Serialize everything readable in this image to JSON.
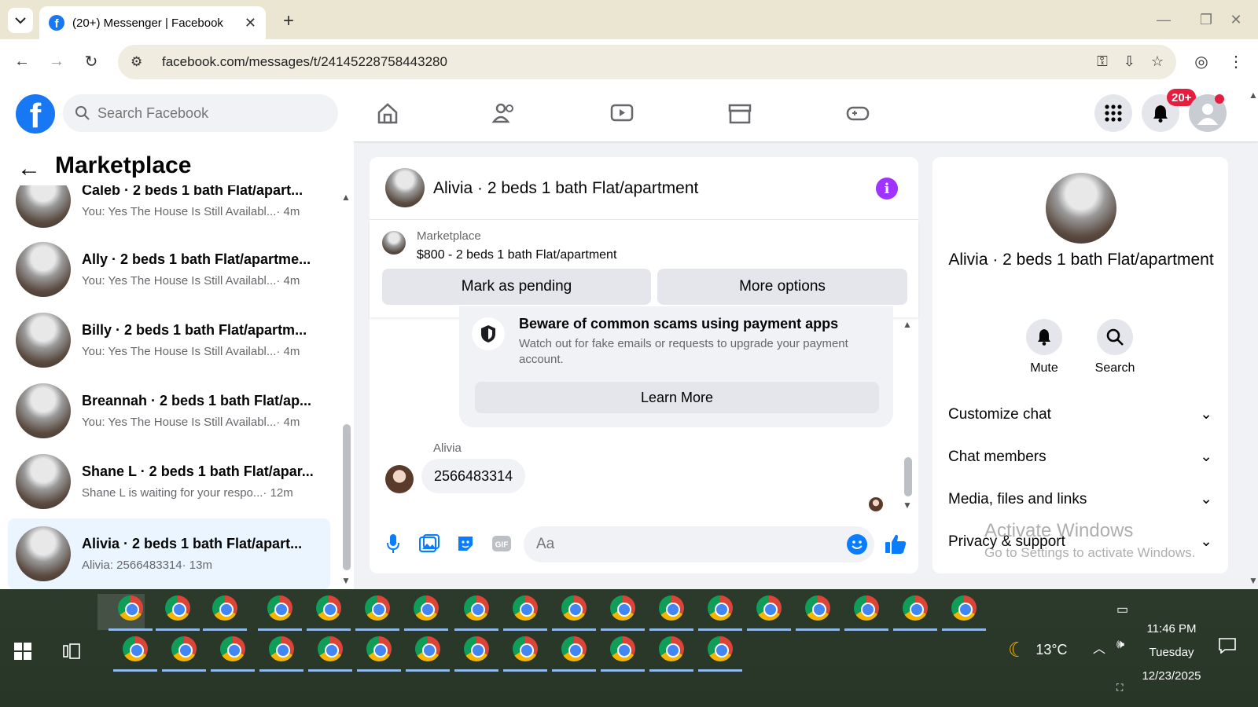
{
  "browser": {
    "tab_title": "(20+) Messenger | Facebook",
    "url": "facebook.com/messages/t/24145228758443280"
  },
  "fb": {
    "search_placeholder": "Search Facebook",
    "notif_badge": "20+",
    "brand_color": "#1877f2"
  },
  "left": {
    "title": "Marketplace",
    "chats": [
      {
        "title": "Caleb · 2 beds 1 bath Flat/apart...",
        "preview": "You: Yes The House Is Still Availabl...",
        "time": "· 4m"
      },
      {
        "title": "Ally · 2 beds 1 bath Flat/apartme...",
        "preview": "You: Yes The House Is Still Availabl...",
        "time": "· 4m"
      },
      {
        "title": "Billy · 2 beds 1 bath Flat/apartm...",
        "preview": "You: Yes The House Is Still Availabl...",
        "time": "· 4m"
      },
      {
        "title": "Breannah · 2 beds 1 bath Flat/ap...",
        "preview": "You: Yes The House Is Still Availabl...",
        "time": "· 4m"
      },
      {
        "title": "Shane L · 2 beds 1 bath Flat/apar...",
        "preview": "Shane L is waiting for your respo...",
        "time": "· 12m"
      },
      {
        "title": "Alivia · 2 beds 1 bath Flat/apart...",
        "preview": "Alivia: 2566483314",
        "time": "· 13m"
      }
    ]
  },
  "chat": {
    "title": "Alivia · 2 beds 1 bath Flat/apartment",
    "listing_source": "Marketplace",
    "listing_price": "$800 - 2 beds 1 bath Flat/apartment",
    "mark_pending": "Mark as pending",
    "more_options": "More options",
    "scam_title": "Beware of common scams using payment apps",
    "scam_body": "Watch out for fake emails or requests to upgrade your payment account.",
    "learn_more": "Learn More",
    "sender": "Alivia",
    "message": "2566483314",
    "input_placeholder": "Aa"
  },
  "info": {
    "title": "Alivia · 2 beds 1 bath Flat/apartment",
    "mute": "Mute",
    "search": "Search",
    "sections": [
      "Customize chat",
      "Chat members",
      "Media, files and links",
      "Privacy & support"
    ],
    "watermark_title": "Activate Windows",
    "watermark_body": "Go to Settings to activate Windows."
  },
  "taskbar": {
    "weather": "13°C",
    "time": "11:46 PM",
    "day": "Tuesday",
    "date": "12/23/2025"
  }
}
